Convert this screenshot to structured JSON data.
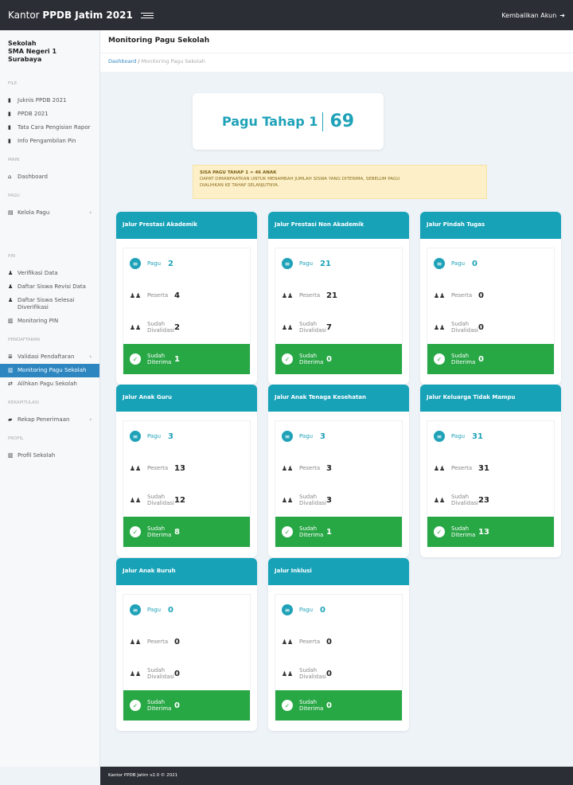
{
  "topbar": {
    "brand_prefix": "Kantor ",
    "brand_bold": "PPDB Jatim 2021",
    "account_label": "Kembalikan Akun"
  },
  "sidebar": {
    "school_line1": "Sekolah",
    "school_line2": "SMA Negeri 1 Surabaya",
    "sections": [
      {
        "title": "FILE",
        "items": [
          {
            "label": "Juknis PPDB 2021",
            "icon": "book-icon"
          },
          {
            "label": "PPDB 2021",
            "icon": "book-icon"
          },
          {
            "label": "Tata Cara Pengisian Rapor",
            "icon": "book-icon"
          },
          {
            "label": "Info Pengambilan Pin",
            "icon": "book-icon"
          }
        ]
      },
      {
        "title": "MAIN",
        "items": [
          {
            "label": "Dashboard",
            "icon": "home-icon"
          }
        ]
      },
      {
        "title": "PAGU",
        "items": [
          {
            "label": "Kelola Pagu",
            "icon": "calendar-icon",
            "caret": "‹"
          }
        ]
      },
      {
        "title": "PIN",
        "items": [
          {
            "label": "Verifikasi Data",
            "icon": "user-icon"
          },
          {
            "label": "Daftar Siswa Revisi Data",
            "icon": "user-icon"
          },
          {
            "label": "Daftar Siswa Selesai Diverifikasi",
            "icon": "user-icon"
          },
          {
            "label": "Monitoring PIN",
            "icon": "bar-chart-icon"
          }
        ]
      },
      {
        "title": "PENDAFTARAN",
        "items": [
          {
            "label": "Validasi Pendaftaran",
            "icon": "stack-icon",
            "caret": "‹"
          },
          {
            "label": "Monitoring Pagu Sekolah",
            "icon": "bar-chart-icon",
            "active": true
          },
          {
            "label": "Alihkan Pagu Sekolah",
            "icon": "swap-icon"
          }
        ]
      },
      {
        "title": "REKAPITULASI",
        "items": [
          {
            "label": "Rekap Penerimaan",
            "icon": "folder-icon",
            "caret": "‹"
          }
        ]
      },
      {
        "title": "PROFIL",
        "items": [
          {
            "label": "Profil Sekolah",
            "icon": "bank-icon"
          }
        ]
      }
    ]
  },
  "header": {
    "title": "Monitoring Pagu Sekolah"
  },
  "breadcrumb": {
    "link": "Dashboard",
    "separator": "/",
    "current": "Monitoring Pagu Sekolah"
  },
  "pagu_summary": {
    "label": "Pagu Tahap 1",
    "value": "69"
  },
  "alert": {
    "title": "SISA PAGU TAHAP 1 = 46 ANAK",
    "line1": "DAPAT DIMANFAATKAN UNTUK MENAMBAH JUMLAH SISWA YANG DITERIMA, SEBELUM PAGU",
    "line2": "DIALIHKAN KE TAHAP SELANJUTNYA."
  },
  "labels": {
    "pagu": "Pagu",
    "peserta": "Peserta",
    "divalidasi_1": "Sudah",
    "divalidasi_2": "Divalidasi",
    "diterima_1": "Sudah",
    "diterima_2": "Diterima"
  },
  "cards": [
    {
      "title": "Jalur Prestasi Akademik",
      "pagu": "2",
      "peserta": "4",
      "divalidasi": "2",
      "diterima": "1"
    },
    {
      "title": "Jalur Prestasi Non Akademik",
      "pagu": "21",
      "peserta": "21",
      "divalidasi": "7",
      "diterima": "0"
    },
    {
      "title": "Jalur Pindah Tugas",
      "pagu": "0",
      "peserta": "0",
      "divalidasi": "0",
      "diterima": "0"
    },
    {
      "title": "Jalur Anak Guru",
      "pagu": "3",
      "peserta": "13",
      "divalidasi": "12",
      "diterima": "8"
    },
    {
      "title": "Jalur Anak Tenaga Kesehatan",
      "pagu": "3",
      "peserta": "3",
      "divalidasi": "3",
      "diterima": "1"
    },
    {
      "title": "Jalur Keluarga Tidak Mampu",
      "pagu": "31",
      "peserta": "31",
      "divalidasi": "23",
      "diterima": "13"
    },
    {
      "title": "Jalur Anak Buruh",
      "pagu": "0",
      "peserta": "0",
      "divalidasi": "0",
      "diterima": "0"
    },
    {
      "title": "Jalur Inklusi",
      "pagu": "0",
      "peserta": "0",
      "divalidasi": "0",
      "diterima": "0"
    }
  ],
  "footer": {
    "text": "Kantor PPDB Jatim v2.0 © 2021"
  },
  "colors": {
    "accent": "#17a2b8",
    "success": "#28a745",
    "dark": "#2b2e35",
    "active_nav": "#2e86c1"
  }
}
